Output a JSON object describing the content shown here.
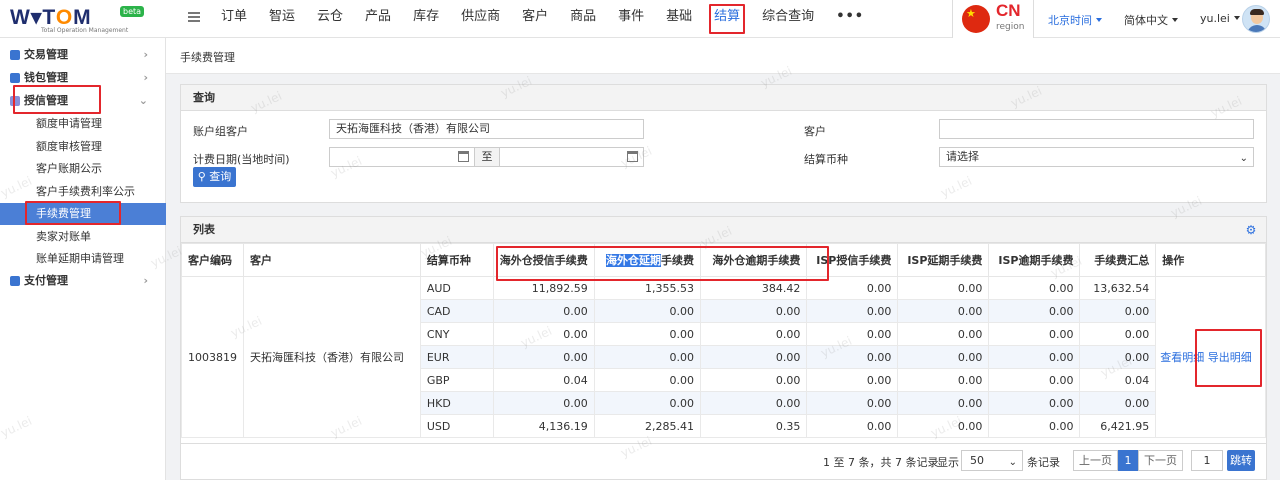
{
  "brand": {
    "logo_text_a": "W",
    "logo_text_b": "T",
    "logo_text_c": "O",
    "logo_text_d": "M",
    "beta": "beta",
    "subtitle": "Total Operation Management"
  },
  "nav": {
    "items": [
      "订单",
      "智运",
      "云仓",
      "产品",
      "库存",
      "供应商",
      "客户",
      "商品",
      "事件",
      "基础",
      "结算",
      "综合查询",
      "•••"
    ],
    "active": "结算"
  },
  "region": {
    "code": "CN",
    "label": "region"
  },
  "topbar": {
    "timezone": "北京时间",
    "language": "简体中文",
    "user": "yu.lei"
  },
  "sidebar": {
    "groups": [
      {
        "label": "交易管理",
        "color": "#3a74d0"
      },
      {
        "label": "钱包管理",
        "color": "#3a74d0"
      },
      {
        "label": "授信管理",
        "color": "#8a8fd8"
      },
      {
        "label": "支付管理",
        "color": "#3a74d0"
      }
    ],
    "credit_items": [
      "额度申请管理",
      "额度审核管理",
      "客户账期公示",
      "客户手续费利率公示",
      "手续费管理",
      "卖家对账单",
      "账单延期申请管理"
    ],
    "selected": "手续费管理"
  },
  "page": {
    "breadcrumb": "手续费管理"
  },
  "query": {
    "panel_title": "查询",
    "account_group_label": "账户组客户",
    "account_group_value": "天拓海匯科技（香港）有限公司",
    "customer_label": "客户",
    "customer_value": "",
    "date_label": "计费日期(当地时间)",
    "date_sep": "至",
    "currency_label": "结算币种",
    "currency_value": "请选择",
    "search_button": "查询"
  },
  "list": {
    "panel_title": "列表",
    "columns": [
      "客户编码",
      "客户",
      "结算币种",
      "海外仓授信手续费",
      "海外仓延期",
      "手续费",
      "海外仓逾期手续费",
      "ISP授信手续费",
      "ISP延期手续费",
      "ISP逾期手续费",
      "手续费汇总",
      "操作"
    ],
    "customer_code": "1003819",
    "customer_name": "天拓海匯科技（香港）有限公司",
    "rows": [
      [
        "AUD",
        "11,892.59",
        "1,355.53",
        "384.42",
        "0.00",
        "0.00",
        "0.00",
        "13,632.54"
      ],
      [
        "CAD",
        "0.00",
        "0.00",
        "0.00",
        "0.00",
        "0.00",
        "0.00",
        "0.00"
      ],
      [
        "CNY",
        "0.00",
        "0.00",
        "0.00",
        "0.00",
        "0.00",
        "0.00",
        "0.00"
      ],
      [
        "EUR",
        "0.00",
        "0.00",
        "0.00",
        "0.00",
        "0.00",
        "0.00",
        "0.00"
      ],
      [
        "GBP",
        "0.04",
        "0.00",
        "0.00",
        "0.00",
        "0.00",
        "0.00",
        "0.04"
      ],
      [
        "HKD",
        "0.00",
        "0.00",
        "0.00",
        "0.00",
        "0.00",
        "0.00",
        "0.00"
      ],
      [
        "USD",
        "4,136.19",
        "2,285.41",
        "0.35",
        "0.00",
        "0.00",
        "0.00",
        "6,421.95"
      ]
    ],
    "action_view": "查看明细",
    "action_export": "导出明细"
  },
  "pagination": {
    "info": "1 至 7 条，共 7 条记录",
    "show_label": "显示",
    "page_size": "50",
    "records_label": "条记录",
    "prev": "上一页",
    "current": "1",
    "next": "下一页",
    "goto_value": "1",
    "goto_button": "跳转"
  },
  "watermark": "yu.lei",
  "colors": {
    "primary": "#3a74d0",
    "highlight_box": "#e3262c",
    "link": "#2a6ede"
  }
}
